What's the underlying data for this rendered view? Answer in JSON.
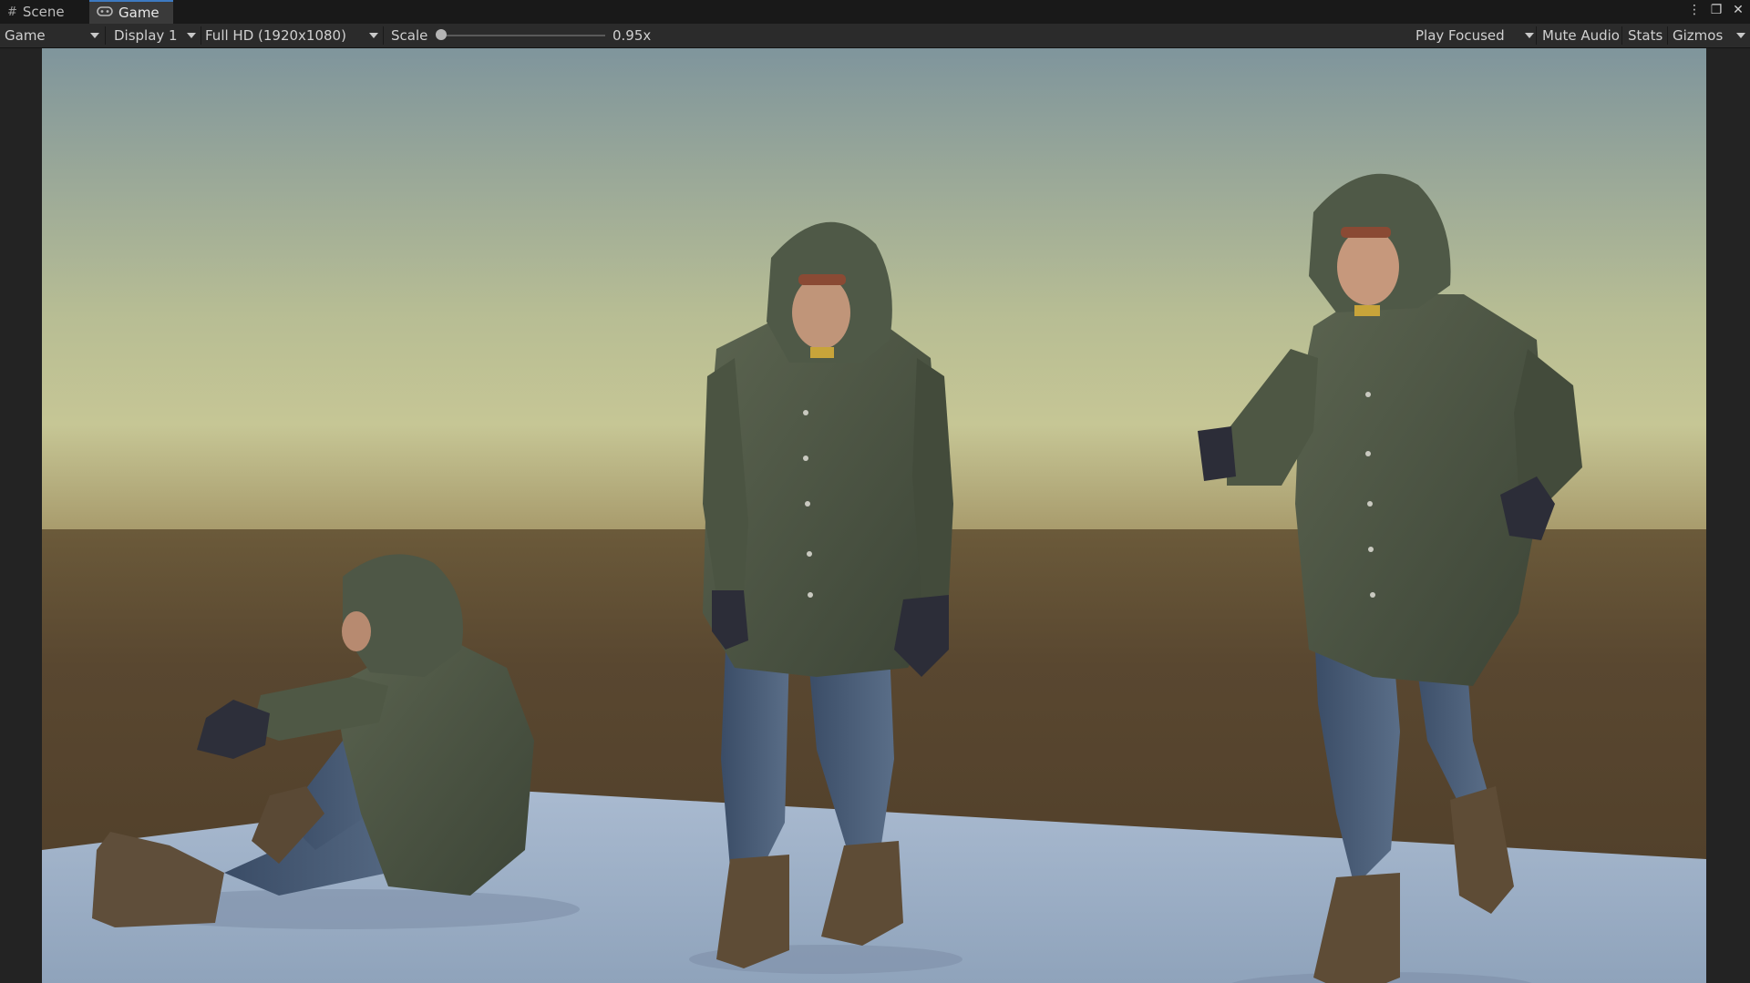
{
  "tabs": [
    {
      "label": "Scene",
      "icon": "grid-icon"
    },
    {
      "label": "Game",
      "icon": "gamepad-icon",
      "active": true
    }
  ],
  "window_controls": [
    "more-icon",
    "maximize-icon",
    "close-icon"
  ],
  "toolbar": {
    "view_mode": "Game",
    "display": "Display 1",
    "resolution": "Full HD (1920x1080)",
    "scale_label": "Scale",
    "scale_value": "0.95x",
    "scale_fraction": 0.0,
    "play_mode": "Play Focused",
    "mute_audio": "Mute Audio",
    "stats": "Stats",
    "gizmos": "Gizmos"
  },
  "scene": {
    "sky_top_color": "#7f959c",
    "sky_horizon_color": "#c3c493",
    "ground_color": "#57452d",
    "floor_color": "#9db0c6",
    "characters": [
      "sitting-character",
      "standing-character",
      "walking-character"
    ]
  }
}
